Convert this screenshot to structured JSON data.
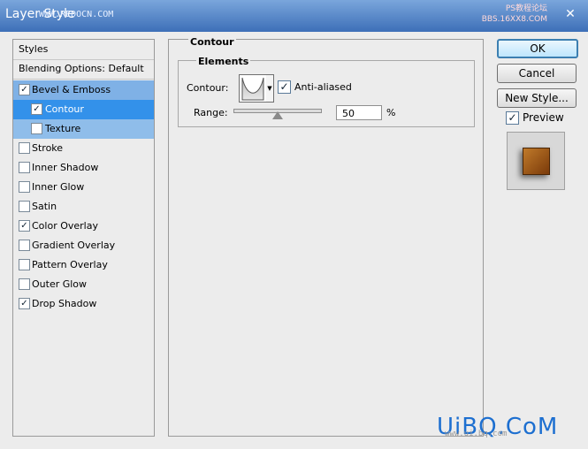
{
  "window": {
    "title": "Layer Style",
    "watermark": "WWW.REDOCN.COM",
    "watermark_right_top": "PS教程论坛",
    "watermark_right_bottom": "BBS.16XX8.COM",
    "close_glyph": "✕"
  },
  "sidebar": {
    "styles_label": "Styles",
    "blending_label": "Blending Options: Default",
    "items": [
      {
        "label": "Bevel & Emboss",
        "checked": true
      },
      {
        "label": "Contour",
        "checked": true
      },
      {
        "label": "Texture",
        "checked": false
      },
      {
        "label": "Stroke",
        "checked": false
      },
      {
        "label": "Inner Shadow",
        "checked": false
      },
      {
        "label": "Inner Glow",
        "checked": false
      },
      {
        "label": "Satin",
        "checked": false
      },
      {
        "label": "Color Overlay",
        "checked": true
      },
      {
        "label": "Gradient Overlay",
        "checked": false
      },
      {
        "label": "Pattern Overlay",
        "checked": false
      },
      {
        "label": "Outer Glow",
        "checked": false
      },
      {
        "label": "Drop Shadow",
        "checked": true
      }
    ]
  },
  "contour_panel": {
    "group_title": "Contour",
    "elements_title": "Elements",
    "contour_label": "Contour:",
    "anti_aliased_label": "Anti-aliased",
    "anti_aliased_checked": true,
    "range_label": "Range:",
    "range_value": "50",
    "range_unit": "%",
    "range_fraction": 0.5
  },
  "buttons": {
    "ok": "OK",
    "cancel": "Cancel",
    "new_style": "New Style...",
    "preview_label": "Preview",
    "preview_checked": true
  },
  "check_glyph": "✓",
  "footer": {
    "logo": "UiBQ.CoM",
    "sub": "www.ui.bq.com"
  }
}
